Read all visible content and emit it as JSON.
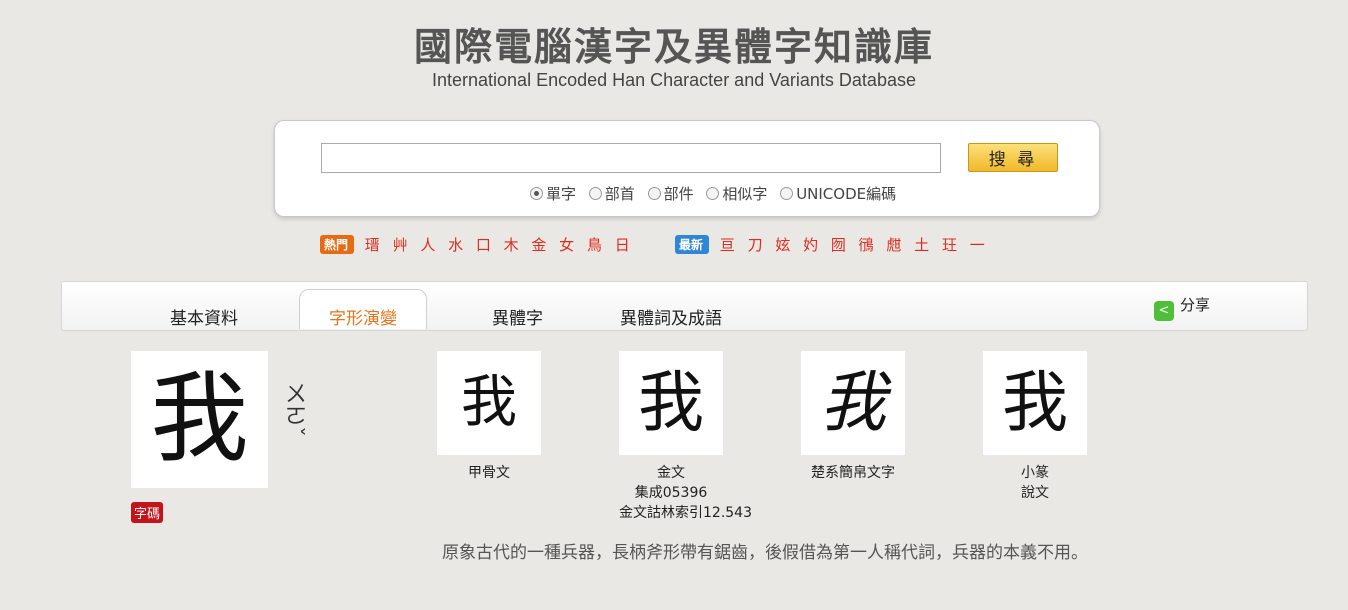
{
  "header": {
    "title_zh": "國際電腦漢字及異體字知識庫",
    "title_en": "International Encoded Han Character and Variants Database"
  },
  "search": {
    "value": "",
    "button": "搜 尋",
    "options": [
      "單字",
      "部首",
      "部件",
      "相似字",
      "UNICODE編碼"
    ],
    "selected": "單字"
  },
  "hot": {
    "label": "熱門",
    "chars": "瑨 艸 人 水 口 木 金 女 鳥 日"
  },
  "new": {
    "label": "最新",
    "chars": "亘 刀 妶 妁 囫 鴴 甝 土 玨 一"
  },
  "tabs": [
    "基本資料",
    "字形演變",
    "異體字",
    "異體詞及成語"
  ],
  "active_tab": "字形演變",
  "share_label": "分享",
  "character": {
    "char": "我",
    "zhuyin": "ㄨㄛˇ",
    "code_label": "字碼"
  },
  "glyphs": [
    {
      "glyph": "我",
      "caption": [
        "甲骨文"
      ]
    },
    {
      "glyph": "我",
      "caption": [
        "金文",
        "集成05396",
        "金文詁林索引12.543"
      ]
    },
    {
      "glyph": "我",
      "caption": [
        "楚系簡帛文字"
      ]
    },
    {
      "glyph": "我",
      "caption": [
        "小篆",
        "說文"
      ]
    }
  ],
  "description": "原象古代的一種兵器，長柄斧形帶有鋸齒，後假借為第一人稱代詞，兵器的本義不用。",
  "colors": {
    "accent": "#e8731a",
    "hot": "#e02a1d",
    "search_button": "#f0b92a",
    "share": "#4fbf3a"
  }
}
